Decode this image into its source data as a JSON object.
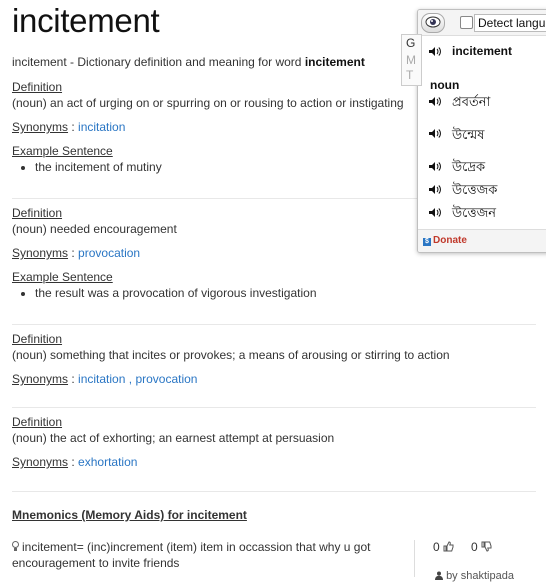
{
  "page": {
    "title": "incitement",
    "subtitle_prefix": "incitement - Dictionary definition and meaning for word ",
    "subtitle_word": "incitement"
  },
  "labels": {
    "definition": "Definition",
    "synonyms": "Synonyms",
    "synonyms_sep": " : ",
    "example": "Example Sentence"
  },
  "senses": [
    {
      "definition": "(noun) an act of urging on or spurring on or rousing to action or instigating",
      "synonyms": [
        "incitation"
      ],
      "examples": [
        "the incitement of mutiny"
      ]
    },
    {
      "definition": "(noun) needed encouragement",
      "synonyms": [
        "provocation"
      ],
      "examples": [
        "the result was a provocation of vigorous investigation"
      ]
    },
    {
      "definition": "(noun) something that incites or provokes; a means of arousing or stirring to action",
      "synonyms": [
        "incitation",
        "provocation"
      ],
      "examples": []
    },
    {
      "definition": "(noun) the act of exhorting; an earnest attempt at persuasion",
      "synonyms": [
        "exhortation"
      ],
      "examples": []
    }
  ],
  "mnemonics": {
    "heading": "Mnemonics (Memory Aids) for incitement",
    "entry_text": "incitement= (inc)increment (item) item in occassion that why u got encouragement to invite friends",
    "upvotes": "0",
    "downvotes": "0",
    "author": "by shaktipada"
  },
  "popup": {
    "detect_language_label": "Detect langu",
    "detect_checked": false,
    "tabs": [
      "G",
      "M",
      "T"
    ],
    "word": "incitement",
    "part_of_speech": "noun",
    "translations": [
      "প্রবর্তনা",
      "উন্মেষ",
      "উদ্রেক",
      "উত্তেজক",
      "উত্তেজন"
    ],
    "donate_label": "Donate",
    "icons": {
      "eye": "eye-icon",
      "speaker": "speaker-icon",
      "donate": "donate-icon"
    }
  },
  "colors": {
    "link": "#2a76c4",
    "text": "#333333",
    "donate": "#c0392b"
  }
}
